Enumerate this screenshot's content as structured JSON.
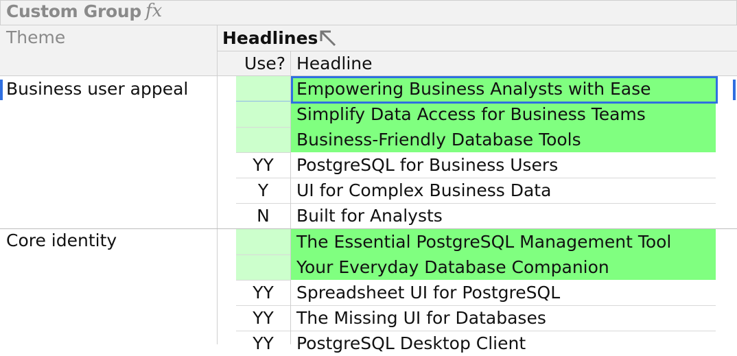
{
  "header": {
    "group_title": "Custom Group",
    "fx_label": "fx",
    "theme_label": "Theme",
    "headlines_label": "Headlines",
    "use_label": "Use?",
    "headline_label": "Headline"
  },
  "colors": {
    "green_use": "#ccffcc",
    "green_headline": "#80ff80",
    "selection": "#2f6fe0"
  },
  "groups": [
    {
      "theme": "Business user appeal",
      "rows": [
        {
          "use": "",
          "headline": "Empowering Business Analysts with Ease",
          "highlight": true
        },
        {
          "use": "",
          "headline": "Simplify Data Access for Business Teams",
          "highlight": true
        },
        {
          "use": "",
          "headline": "Business-Friendly Database Tools",
          "highlight": true
        },
        {
          "use": "YY",
          "headline": "PostgreSQL for Business Users",
          "highlight": false
        },
        {
          "use": "Y",
          "headline": "UI for Complex Business Data",
          "highlight": false
        },
        {
          "use": "N",
          "headline": "Built for Analysts",
          "highlight": false
        }
      ]
    },
    {
      "theme": "Core identity",
      "rows": [
        {
          "use": "",
          "headline": "The Essential PostgreSQL Management Tool",
          "highlight": true
        },
        {
          "use": "",
          "headline": "Your Everyday Database Companion",
          "highlight": true
        },
        {
          "use": "YY",
          "headline": "Spreadsheet UI for PostgreSQL",
          "highlight": false
        },
        {
          "use": "YY",
          "headline": "The Missing UI for Databases",
          "highlight": false
        },
        {
          "use": "YY",
          "headline": "PostgreSQL Desktop Client",
          "highlight": false
        }
      ]
    }
  ]
}
